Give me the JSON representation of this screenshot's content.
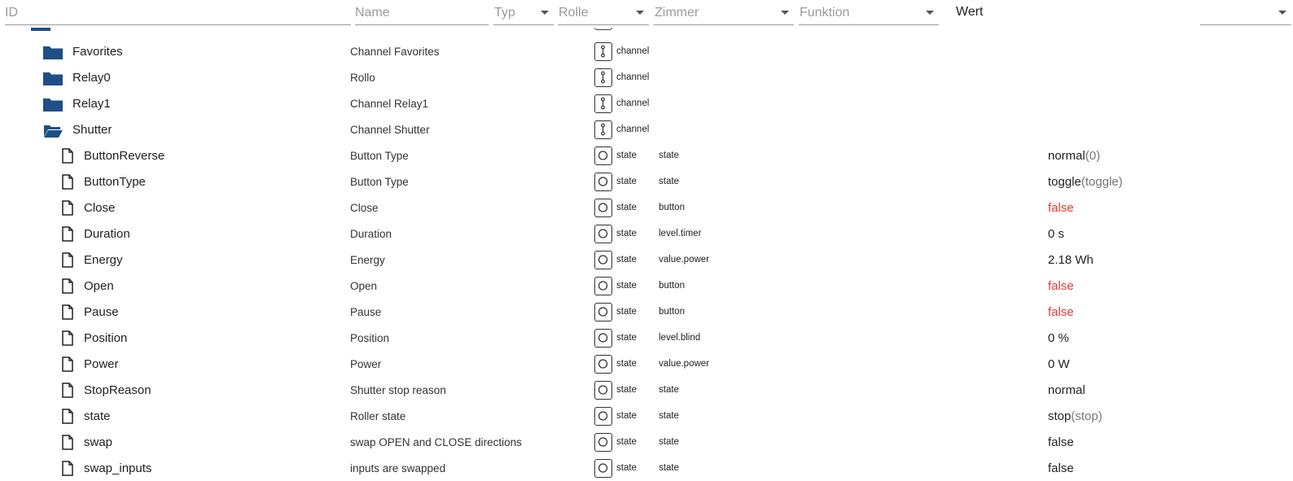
{
  "header": {
    "id_placeholder": "ID",
    "name_placeholder": "Name",
    "typ_label": "Typ",
    "rolle_label": "Rolle",
    "zimmer_label": "Zimmer",
    "funktion_label": "Funktion",
    "wert_label": "Wert"
  },
  "channels": [
    {
      "name": "Favorites",
      "desc": "Channel Favorites",
      "type": "channel",
      "open": false
    },
    {
      "name": "Relay0",
      "desc": "Rollo",
      "type": "channel",
      "open": false
    },
    {
      "name": "Relay1",
      "desc": "Channel Relay1",
      "type": "channel",
      "open": false
    },
    {
      "name": "Shutter",
      "desc": "Channel Shutter",
      "type": "channel",
      "open": true
    }
  ],
  "states": [
    {
      "name": "ButtonReverse",
      "desc": "Button Type",
      "type": "state",
      "role": "state",
      "value": "normal",
      "paren": "(0)",
      "color": "#222222"
    },
    {
      "name": "ButtonType",
      "desc": "Button Type",
      "type": "state",
      "role": "state",
      "value": "toggle",
      "paren": "(toggle)",
      "color": "#222222"
    },
    {
      "name": "Close",
      "desc": "Close",
      "type": "state",
      "role": "button",
      "value": "false",
      "paren": "",
      "color": "#e53935"
    },
    {
      "name": "Duration",
      "desc": "Duration",
      "type": "state",
      "role": "level.timer",
      "value": "0 s",
      "paren": "",
      "color": "#222222"
    },
    {
      "name": "Energy",
      "desc": "Energy",
      "type": "state",
      "role": "value.power",
      "value": "2.18 Wh",
      "paren": "",
      "color": "#222222"
    },
    {
      "name": "Open",
      "desc": "Open",
      "type": "state",
      "role": "button",
      "value": "false",
      "paren": "",
      "color": "#e53935"
    },
    {
      "name": "Pause",
      "desc": "Pause",
      "type": "state",
      "role": "button",
      "value": "false",
      "paren": "",
      "color": "#e53935"
    },
    {
      "name": "Position",
      "desc": "Position",
      "type": "state",
      "role": "level.blind",
      "value": "0 %",
      "paren": "",
      "color": "#222222"
    },
    {
      "name": "Power",
      "desc": "Power",
      "type": "state",
      "role": "value.power",
      "value": "0 W",
      "paren": "",
      "color": "#222222"
    },
    {
      "name": "StopReason",
      "desc": "Shutter stop reason",
      "type": "state",
      "role": "state",
      "value": "normal",
      "paren": "",
      "color": "#222222"
    },
    {
      "name": "state",
      "desc": "Roller state",
      "type": "state",
      "role": "state",
      "value": "stop",
      "paren": "(stop)",
      "color": "#222222"
    },
    {
      "name": "swap",
      "desc": "swap OPEN and CLOSE directions",
      "type": "state",
      "role": "state",
      "value": "false",
      "paren": "",
      "color": "#222222"
    },
    {
      "name": "swap_inputs",
      "desc": "inputs are swapped",
      "type": "state",
      "role": "state",
      "value": "false",
      "paren": "",
      "color": "#222222"
    }
  ],
  "colors": {
    "folder": "#1e4f86",
    "false_value": "#e53935"
  },
  "icons": {
    "folder": "folder-icon",
    "folder_open": "folder-open-icon",
    "file": "file-icon",
    "channel": "channel-icon",
    "state": "state-icon"
  }
}
